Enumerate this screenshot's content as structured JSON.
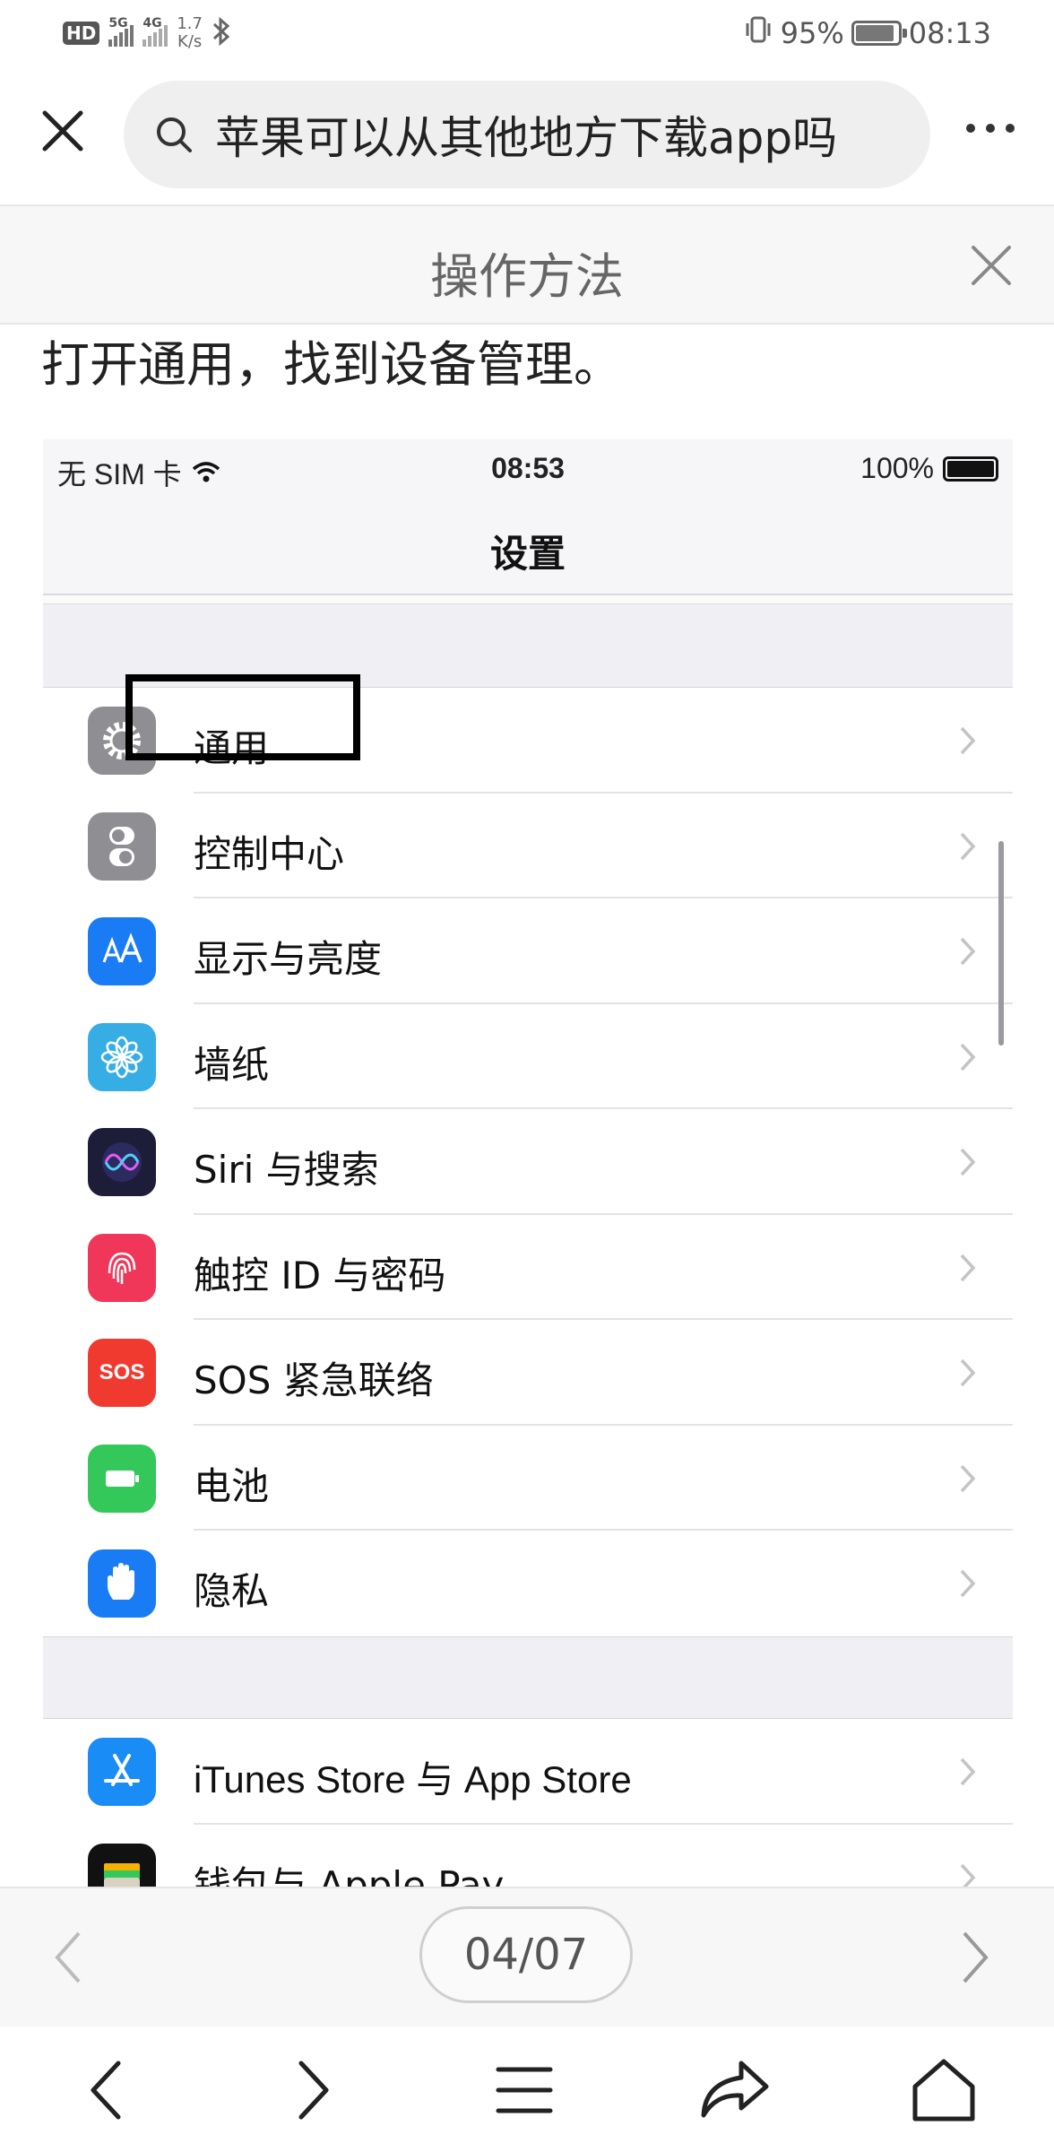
{
  "status_bar": {
    "hd_badge": "HD",
    "sim1_tag": "5G",
    "sim2_tag": "4G",
    "speed_value": "1.7",
    "speed_unit": "K/s",
    "battery_percent": "95%",
    "time": "08:13"
  },
  "search": {
    "query": "苹果可以从其他地方下载app吗"
  },
  "method": {
    "title": "操作方法",
    "instruction": "打开通用，找到设备管理。"
  },
  "screenshot": {
    "status_left": "无 SIM 卡",
    "status_time": "08:53",
    "status_battery": "100%",
    "nav_title": "设置",
    "rows": [
      {
        "label": "通用",
        "icon": "gear-icon",
        "color": "#8e8e93"
      },
      {
        "label": "控制中心",
        "icon": "toggles-icon",
        "color": "#8e8e93"
      },
      {
        "label": "显示与亮度",
        "icon": "aa-icon",
        "color": "#1a7cf5"
      },
      {
        "label": "墙纸",
        "icon": "flower-icon",
        "color": "#36aee5"
      },
      {
        "label": "Siri 与搜索",
        "icon": "siri-icon",
        "color": "#1d1d3a"
      },
      {
        "label": "触控 ID 与密码",
        "icon": "fingerprint-icon",
        "color": "#f0375a"
      },
      {
        "label": "SOS 紧急联络",
        "icon": "sos-icon",
        "color": "#f03a30",
        "icon_text": "SOS"
      },
      {
        "label": "电池",
        "icon": "battery-icon",
        "color": "#34c759"
      },
      {
        "label": "隐私",
        "icon": "hand-icon",
        "color": "#1a7cf5"
      }
    ],
    "rows2": [
      {
        "label": "iTunes Store 与 App Store",
        "icon": "app-store-icon",
        "color": "#1a8cf5"
      },
      {
        "label": "钱包与 Apple Pay",
        "icon": "wallet-icon",
        "color": "#111111"
      }
    ]
  },
  "pager": {
    "indicator": "04/07"
  },
  "toolbar": {
    "icons": [
      "back-icon",
      "forward-icon",
      "menu-icon",
      "share-icon",
      "home-icon"
    ]
  }
}
